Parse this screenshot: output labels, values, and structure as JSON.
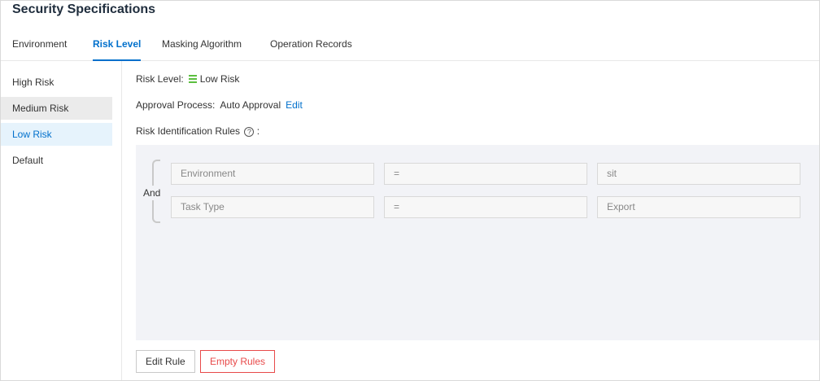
{
  "page": {
    "title": "Security Specifications"
  },
  "tabs": [
    {
      "label": "Environment",
      "active": false
    },
    {
      "label": "Risk Level",
      "active": true
    },
    {
      "label": "Masking Algorithm",
      "active": false
    },
    {
      "label": "Operation Records",
      "active": false
    }
  ],
  "sidebar": {
    "items": [
      {
        "label": "High Risk"
      },
      {
        "label": "Medium Risk"
      },
      {
        "label": "Low Risk"
      },
      {
        "label": "Default"
      }
    ],
    "hovered": "Medium Risk",
    "selected": "Low Risk"
  },
  "detail": {
    "risk_level_label": "Risk Level:",
    "risk_level_value": "Low Risk",
    "risk_level_icon": "signal-bars-icon",
    "risk_level_color": "#5cbf40",
    "approval_label": "Approval Process:",
    "approval_value": "Auto Approval",
    "approval_edit": "Edit",
    "rules_label": "Risk Identification Rules",
    "rules_colon": ":",
    "help_icon": "question-circle-icon"
  },
  "rules": {
    "logic": "And",
    "conditions": [
      {
        "field": "Environment",
        "operator": "=",
        "value": "sit"
      },
      {
        "field": "Task Type",
        "operator": "=",
        "value": "Export"
      }
    ]
  },
  "actions": {
    "edit_rule": "Edit Rule",
    "empty_rules": "Empty Rules"
  },
  "colors": {
    "accent": "#0070cc",
    "danger": "#e84a4a",
    "low_risk": "#5cbf40"
  }
}
